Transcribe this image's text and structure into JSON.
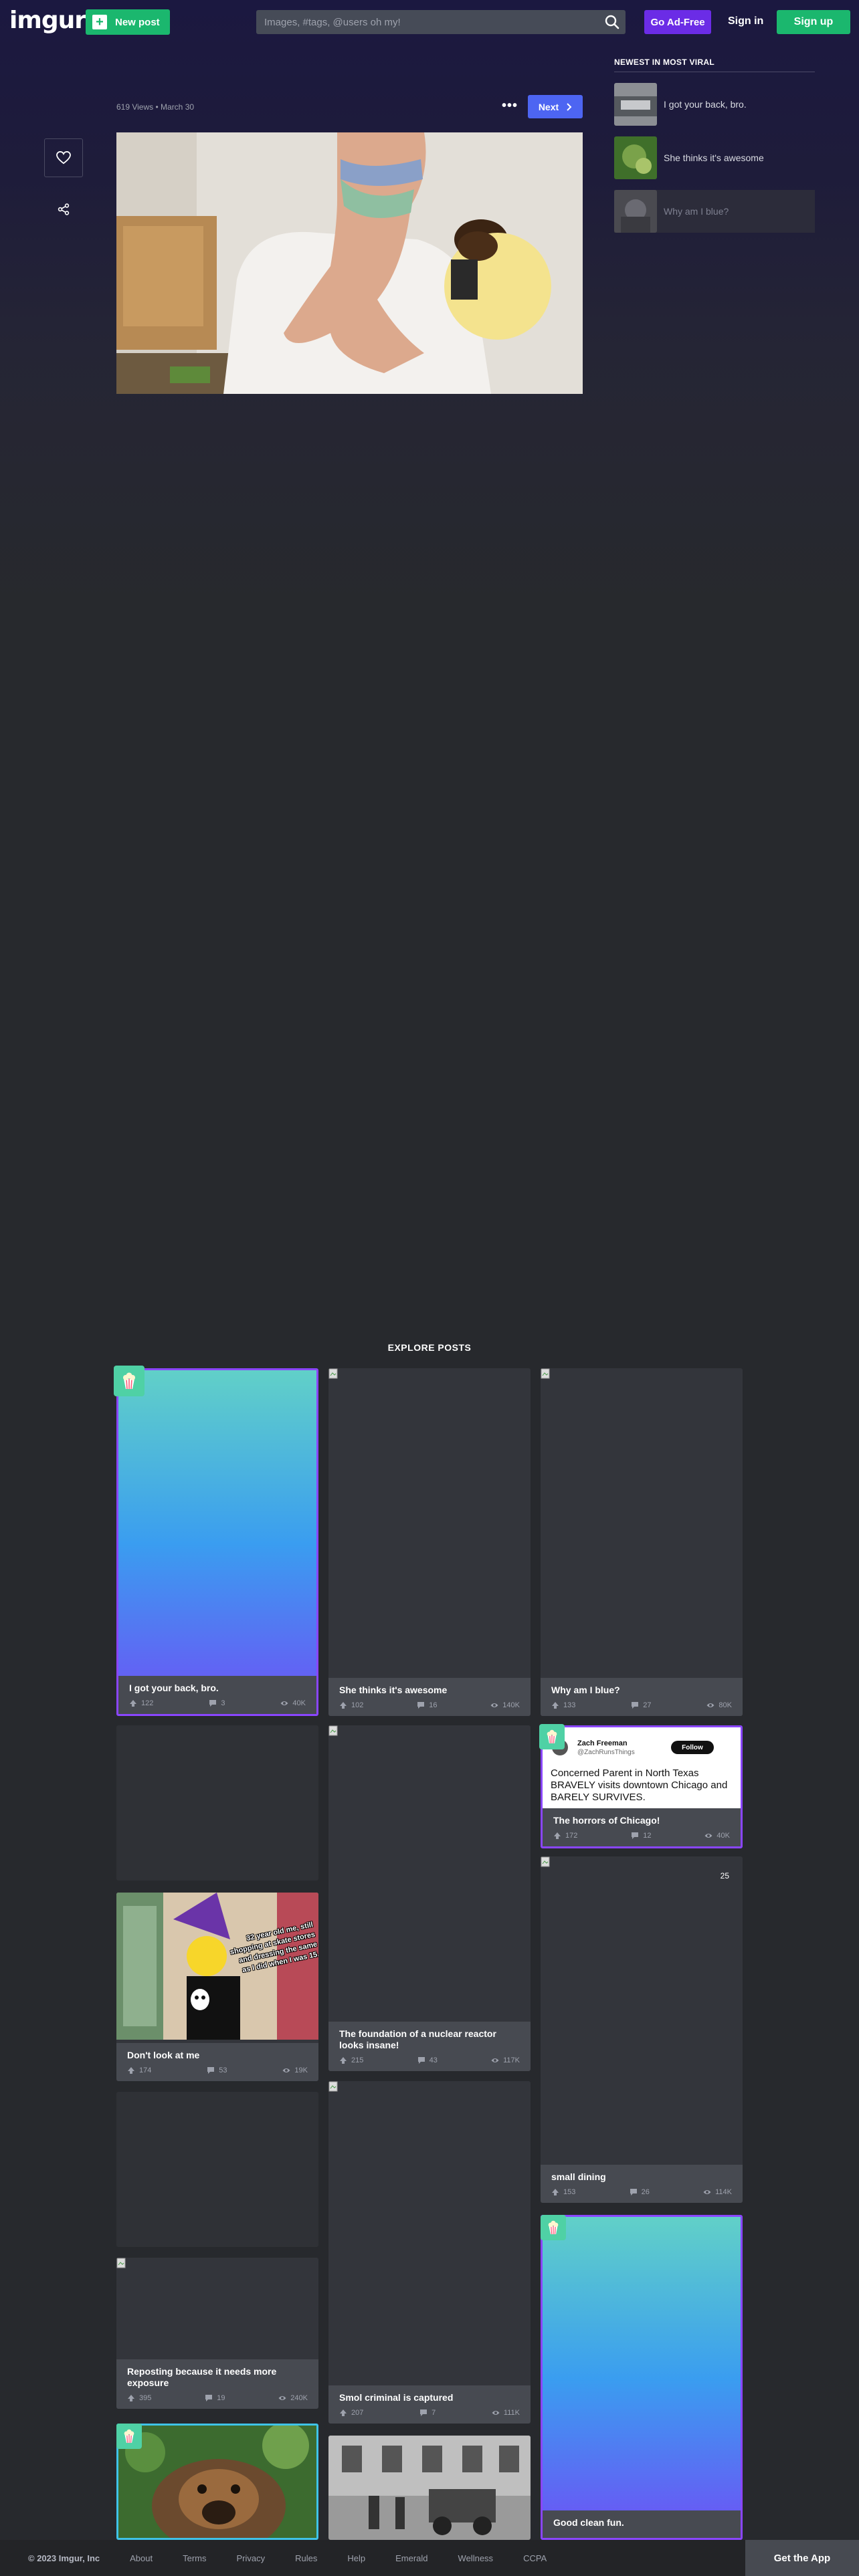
{
  "header": {
    "logo": "imgur",
    "new_post": "New post",
    "search_placeholder": "Images, #tags, @users oh my!",
    "ad_free": "Go Ad-Free",
    "sign_in": "Sign in",
    "sign_up": "Sign up"
  },
  "post": {
    "meta": "619 Views • March 30",
    "next": "Next"
  },
  "sidebar": {
    "title": "NEWEST IN MOST VIRAL",
    "items": [
      {
        "label": "I got your back, bro."
      },
      {
        "label": "She thinks it's awesome"
      },
      {
        "label": "Why am I blue?"
      }
    ]
  },
  "explore": {
    "title": "EXPLORE POSTS",
    "cards": [
      {
        "title": "I got your back, bro.",
        "up": "122",
        "comments": "3",
        "views": "40K"
      },
      {
        "title": "She thinks it's awesome",
        "up": "102",
        "comments": "16",
        "views": "140K"
      },
      {
        "title": "Why am I blue?",
        "up": "133",
        "comments": "27",
        "views": "80K"
      },
      {
        "title": "The horrors of Chicago!",
        "up": "172",
        "comments": "12",
        "views": "40K",
        "tweet_name": "Zach Freeman",
        "tweet_handle": "@ZachRunsThings",
        "tweet_follow": "Follow",
        "tweet_text": "Concerned Parent in North Texas BRAVELY visits downtown Chicago and BARELY SURVIVES."
      },
      {
        "title": "Don't look at me",
        "up": "174",
        "comments": "53",
        "views": "19K",
        "meme_text": "32 year old me, still shopping at skate stores and dressing the same as I did when I was 15."
      },
      {
        "title": "The foundation of a nuclear reactor looks insane!",
        "up": "215",
        "comments": "43",
        "views": "117K"
      },
      {
        "title": "small dining",
        "up": "153",
        "comments": "26",
        "views": "114K",
        "badge": "25"
      },
      {
        "title": "Reposting because it needs more exposure",
        "up": "395",
        "comments": "19",
        "views": "240K"
      },
      {
        "title": "Smol criminal is captured",
        "up": "207",
        "comments": "7",
        "views": "111K"
      },
      {
        "title": "Good clean fun.",
        "up": "",
        "comments": "",
        "views": ""
      }
    ]
  },
  "footer": {
    "copyright": "© 2023 Imgur, Inc",
    "links": [
      "About",
      "Terms",
      "Privacy",
      "Rules",
      "Help",
      "Emerald",
      "Wellness",
      "CCPA"
    ],
    "get_app": "Get the App"
  },
  "colors": {
    "green": "#1bb76e",
    "purple": "#6b2ce6",
    "blue": "#4d65f2",
    "viral_border": "#8a46ff"
  }
}
